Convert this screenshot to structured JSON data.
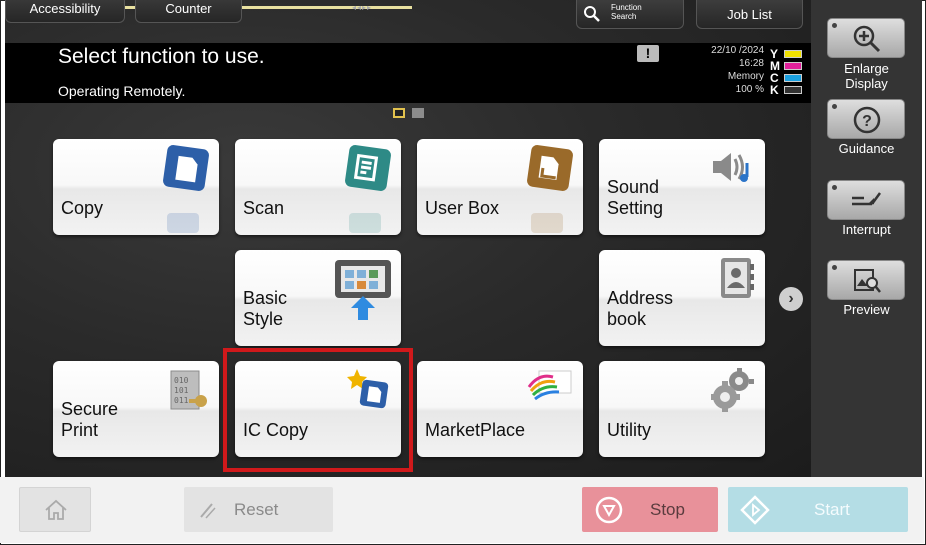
{
  "top_tabs": {
    "accessibility": "Accessibility",
    "counter": "Counter",
    "function_search": "Function\nSearch",
    "job_list": "Job List"
  },
  "header": {
    "title": "Select function to use.",
    "status_line": "Operating Remotely.",
    "date": "22/10 /2024",
    "time": "16:28",
    "memory_label": "Memory",
    "memory_value": "100 %",
    "toner": [
      {
        "letter": "Y",
        "color": "#f0e000"
      },
      {
        "letter": "M",
        "color": "#e0209a"
      },
      {
        "letter": "C",
        "color": "#1aa0e0"
      },
      {
        "letter": "K",
        "color": "#333333"
      }
    ]
  },
  "tiles": {
    "copy": "Copy",
    "scan": "Scan",
    "user_box": "User Box",
    "sound_setting": "Sound\nSetting",
    "basic_style": "Basic\nStyle",
    "address_book": "Address\nbook",
    "secure_print": "Secure\nPrint",
    "ic_copy": "IC Copy",
    "marketplace": "MarketPlace",
    "utility": "Utility"
  },
  "right_panel": {
    "enlarge_display": "Enlarge\nDisplay",
    "guidance": "Guidance",
    "interrupt": "Interrupt",
    "preview": "Preview"
  },
  "bottom": {
    "reset": "Reset",
    "stop": "Stop",
    "start": "Start"
  },
  "colors": {
    "stop_button": "#e8919a",
    "start_button": "#b4dde5",
    "highlight": "#d0191b"
  }
}
